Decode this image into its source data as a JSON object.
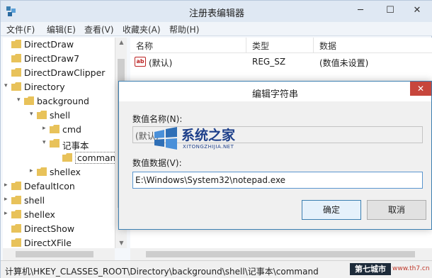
{
  "window": {
    "title": "注册表编辑器",
    "controls": {
      "minimize": "─",
      "maximize": "☐",
      "close": "✕"
    }
  },
  "menu": [
    "文件(F)",
    "编辑(E)",
    "查看(V)",
    "收藏夹(A)",
    "帮助(H)"
  ],
  "tree": {
    "items": [
      {
        "label": "DirectDraw",
        "level": 0,
        "expander": ""
      },
      {
        "label": "DirectDraw7",
        "level": 0,
        "expander": ""
      },
      {
        "label": "DirectDrawClipper",
        "level": 0,
        "expander": ""
      },
      {
        "label": "Directory",
        "level": 0,
        "expander": "▾"
      },
      {
        "label": "background",
        "level": 1,
        "expander": "▾"
      },
      {
        "label": "shell",
        "level": 2,
        "expander": "▾"
      },
      {
        "label": "cmd",
        "level": 3,
        "expander": "▸"
      },
      {
        "label": "记事本",
        "level": 3,
        "expander": "▾"
      },
      {
        "label": "command",
        "level": 4,
        "expander": "",
        "selected": true
      },
      {
        "label": "shellex",
        "level": 2,
        "expander": "▸"
      },
      {
        "label": "DefaultIcon",
        "level": 0,
        "expander": "▸"
      },
      {
        "label": "shell",
        "level": 0,
        "expander": "▸"
      },
      {
        "label": "shellex",
        "level": 0,
        "expander": "▸"
      },
      {
        "label": "DirectShow",
        "level": 0,
        "expander": ""
      },
      {
        "label": "DirectXFile",
        "level": 0,
        "expander": ""
      }
    ]
  },
  "list": {
    "headers": [
      "名称",
      "类型",
      "数据"
    ],
    "rows": [
      {
        "icon": "ab",
        "name": "(默认)",
        "type": "REG_SZ",
        "data": "(数值未设置)"
      }
    ]
  },
  "status": {
    "path": "计算机\\HKEY_CLASSES_ROOT\\Directory\\background\\shell\\记事本\\command"
  },
  "dialog": {
    "title": "编辑字符串",
    "close": "✕",
    "name_label": "数值名称(N):",
    "name_value": "(默认)",
    "data_label": "数值数据(V):",
    "data_value": "E:\\Windows\\System32\\notepad.exe",
    "ok": "确定",
    "cancel": "取消"
  },
  "watermark": {
    "title": "系统之家",
    "subtitle": "XITONGZHIJIA.NET",
    "badge": "第七城市",
    "badge_sub": "www.th7.cn"
  },
  "colors": {
    "folder": "#e8c25a",
    "accent": "#3c7fb1",
    "close_red": "#c7463c"
  }
}
